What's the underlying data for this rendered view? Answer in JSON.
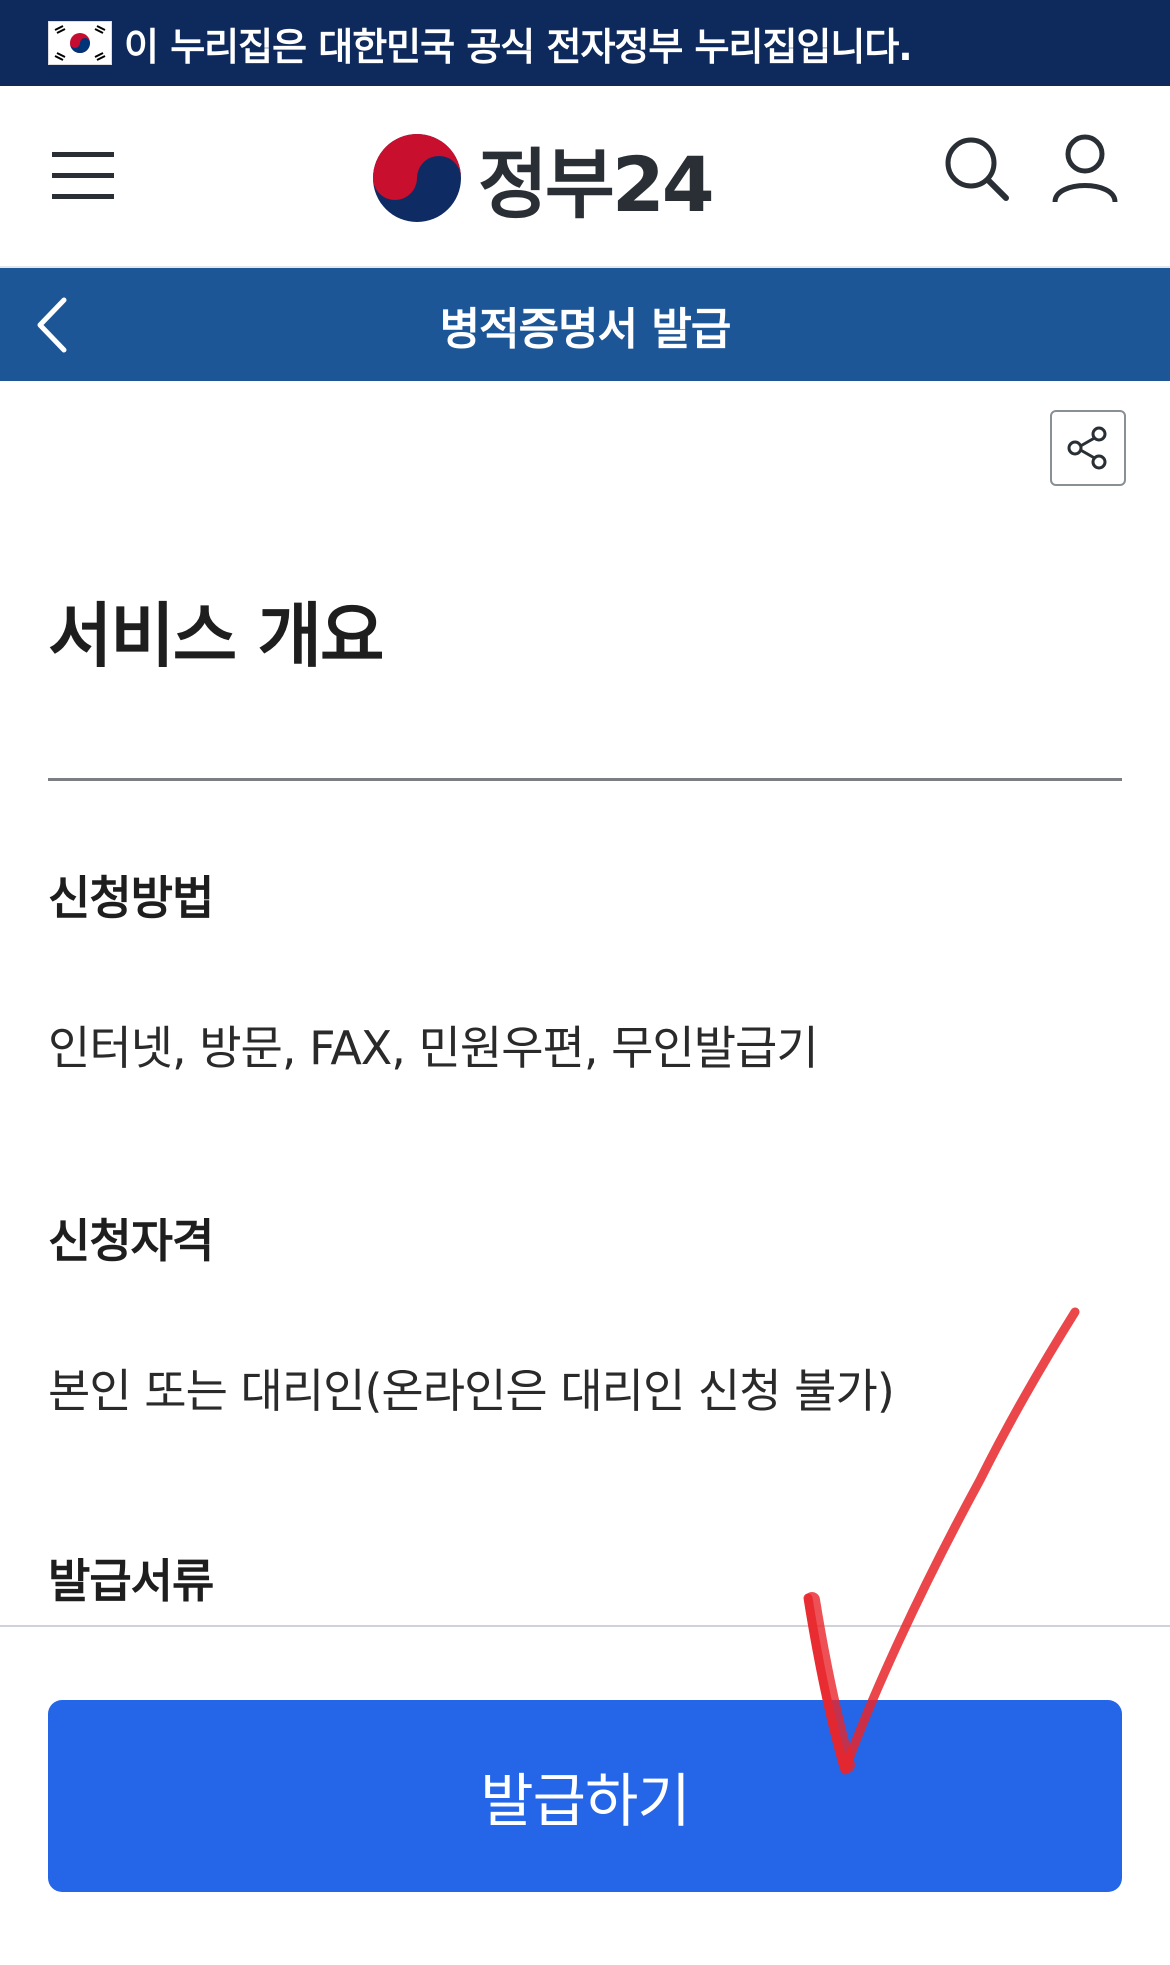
{
  "gov_banner": {
    "text": "이 누리집은 대한민국 공식 전자정부 누리집입니다."
  },
  "header": {
    "logo_text": "정부24",
    "icons": [
      "menu-icon",
      "search-icon",
      "user-icon"
    ]
  },
  "subheader": {
    "title": "병적증명서 발급",
    "back_icon": "chevron-left-icon"
  },
  "share": {
    "icon": "share-icon"
  },
  "overview": {
    "title": "서비스 개요",
    "items": [
      {
        "label": "신청방법",
        "value": "인터넷, 방문, FAX, 민원우편, 무인발급기"
      },
      {
        "label": "신청자격",
        "value": "본인 또는 대리인(온라인은 대리인 신청 불가)"
      },
      {
        "label": "발급서류",
        "value": ""
      }
    ]
  },
  "action": {
    "issue_label": "발급하기"
  },
  "colors": {
    "banner_bg": "#0e2a5c",
    "subheader_bg": "#1d5697",
    "primary_button": "#2566e8",
    "annotation_check": "#e8262a"
  }
}
